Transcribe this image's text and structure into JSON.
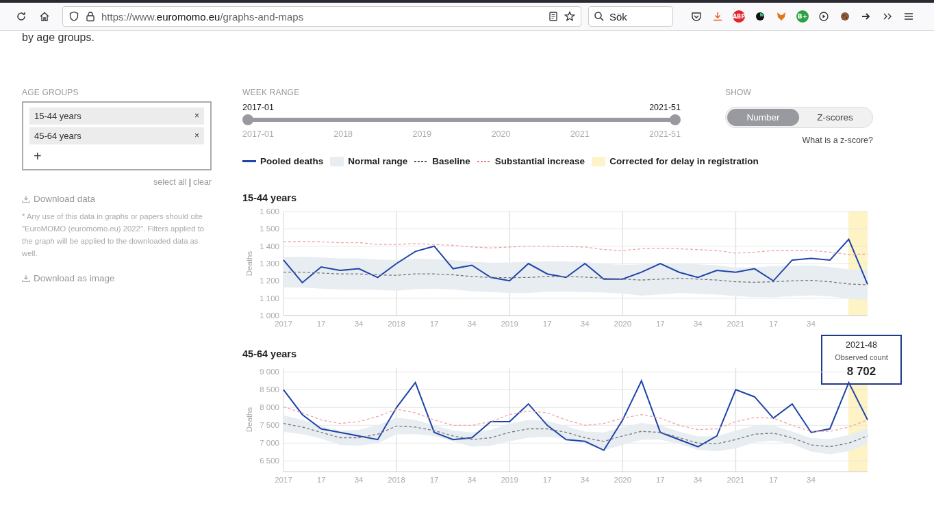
{
  "browser": {
    "url": {
      "prefix": "https://www.",
      "domain": "euromomo.eu",
      "path": "/graphs-and-maps"
    },
    "search": {
      "placeholder": "Sök"
    },
    "extensions": [
      {
        "kind": "abp",
        "label": "ABP"
      },
      {
        "kind": "bplus",
        "label": "B+"
      }
    ]
  },
  "intro": "by age groups.",
  "age_groups": {
    "heading": "AGE GROUPS",
    "chips": [
      {
        "label": "15-44 years",
        "remove": "×"
      },
      {
        "label": "45-64 years",
        "remove": "×"
      }
    ],
    "add": "+",
    "select_all": "select all",
    "separator": "|",
    "clear": "clear"
  },
  "download_data": "Download data",
  "note": "* Any use of this data in graphs or papers should cite \"EuroMOMO (euromomo.eu) 2022\". Filters applied to the graph will be applied to the downloaded data as well.",
  "download_image": "Download as image",
  "week_range": {
    "heading": "WEEK RANGE",
    "start": "2017-01",
    "end": "2021-51",
    "level": 1,
    "ticks": [
      "2017-01",
      "2018",
      "2019",
      "2020",
      "2021",
      "2021-51"
    ]
  },
  "show": {
    "heading": "SHOW",
    "options": [
      {
        "label": "Number",
        "selected": true
      },
      {
        "label": "Z-scores",
        "selected": false
      }
    ],
    "help": "What is a z-score?"
  },
  "legend": [
    {
      "kind": "line",
      "label": "Pooled deaths",
      "color": "#1e44a8"
    },
    {
      "kind": "block",
      "label": "Normal range",
      "color": "#e8edf2"
    },
    {
      "kind": "dashed",
      "label": "Baseline",
      "color": "#555555"
    },
    {
      "kind": "dashed",
      "label": "Substantial increase",
      "color": "#f08080"
    },
    {
      "kind": "block",
      "label": "Corrected for delay in registration",
      "color": "#fdf5c9"
    }
  ],
  "charts": [
    {
      "chart_data": {
        "type": "line",
        "title": "15-44 years",
        "ylabel": "Deaths",
        "categories": [
          "2017",
          null,
          "17",
          null,
          "34",
          null,
          "2018",
          null,
          "17",
          null,
          "34",
          null,
          "2019",
          null,
          "17",
          null,
          "34",
          null,
          "2020",
          null,
          "17",
          null,
          "34",
          null,
          "2021",
          null,
          "17",
          null,
          "34",
          null,
          null,
          null
        ],
        "ylim": [
          1000,
          1600
        ],
        "grid": true,
        "yticks": [
          {
            "value": 1000,
            "label": "1 000"
          },
          {
            "value": 1100,
            "label": "1 100"
          },
          {
            "value": 1200,
            "label": "1 200"
          },
          {
            "value": 1300,
            "label": "1 300"
          },
          {
            "value": 1400,
            "label": "1 400"
          },
          {
            "value": 1500,
            "label": "1 500"
          },
          {
            "value": 1600,
            "label": "1 600"
          }
        ],
        "series": [
          {
            "color": "#1e44a8",
            "line_style": "solid",
            "values": [
              1320,
              1190,
              1280,
              1260,
              1270,
              1220,
              1300,
              1370,
              1400,
              1270,
              1290,
              1220,
              1200,
              1300,
              1240,
              1220,
              1300,
              1210,
              1210,
              1250,
              1300,
              1250,
              1220,
              1260,
              1250,
              1270,
              1200,
              1320,
              1330,
              1320,
              1440,
              1180
            ]
          },
          {
            "color": "#777777",
            "line_style": "dashed",
            "values": [
              1250,
              1250,
              1245,
              1240,
              1240,
              1235,
              1232,
              1240,
              1240,
              1235,
              1225,
              1220,
              1218,
              1220,
              1225,
              1225,
              1222,
              1215,
              1210,
              1205,
              1210,
              1215,
              1210,
              1205,
              1195,
              1192,
              1195,
              1200,
              1203,
              1195,
              1182,
              1178
            ]
          },
          {
            "color": "#f4a3a3",
            "line_style": "dashed",
            "values": [
              1425,
              1428,
              1425,
              1420,
              1420,
              1410,
              1410,
              1415,
              1410,
              1405,
              1395,
              1390,
              1395,
              1400,
              1400,
              1398,
              1395,
              1380,
              1375,
              1385,
              1388,
              1385,
              1380,
              1375,
              1360,
              1365,
              1375,
              1375,
              1375,
              1365,
              1352,
              1355
            ]
          }
        ]
      }
    },
    {
      "chart_data": {
        "type": "line",
        "title": "45-64 years",
        "ylabel": "Deaths",
        "categories": [
          "2017",
          null,
          "17",
          null,
          "34",
          null,
          "2018",
          null,
          "17",
          null,
          "34",
          null,
          "2019",
          null,
          "17",
          null,
          "34",
          null,
          "2020",
          null,
          "17",
          null,
          "34",
          null,
          "2021",
          null,
          "17",
          null,
          "34",
          null,
          null,
          null
        ],
        "ylim": [
          6200,
          9120
        ],
        "grid": true,
        "yticks": [
          {
            "value": 6500,
            "label": "6 500"
          },
          {
            "value": 7000,
            "label": "7 000"
          },
          {
            "value": 7500,
            "label": "7 500"
          },
          {
            "value": 8000,
            "label": "8 000"
          },
          {
            "value": 8500,
            "label": "8 500"
          },
          {
            "value": 9000,
            "label": "9 000"
          }
        ],
        "series": [
          {
            "color": "#1e44a8",
            "line_style": "solid",
            "values": [
              8500,
              7800,
              7400,
              7300,
              7200,
              7100,
              8000,
              8700,
              7300,
              7100,
              7150,
              7600,
              7600,
              8100,
              7500,
              7100,
              7050,
              6800,
              7650,
              8750,
              7300,
              7100,
              6900,
              7200,
              8500,
              8300,
              7700,
              8100,
              7300,
              7400,
              8700,
              7650
            ]
          },
          {
            "color": "#777777",
            "line_style": "dashed",
            "values": [
              7550,
              7450,
              7300,
              7150,
              7150,
              7250,
              7480,
              7450,
              7350,
              7200,
              7100,
              7150,
              7300,
              7400,
              7400,
              7300,
              7150,
              7050,
              7200,
              7330,
              7300,
              7150,
              7000,
              6980,
              7100,
              7250,
              7280,
              7150,
              6950,
              6900,
              7000,
              7200
            ]
          },
          {
            "color": "#f4a3a3",
            "line_style": "dashed",
            "values": [
              8020,
              7850,
              7650,
              7550,
              7600,
              7750,
              7950,
              7850,
              7650,
              7500,
              7500,
              7600,
              7800,
              7900,
              7850,
              7650,
              7500,
              7550,
              7700,
              7800,
              7700,
              7500,
              7380,
              7400,
              7600,
              7720,
              7700,
              7500,
              7330,
              7330,
              7450,
              7650
            ]
          }
        ]
      }
    }
  ],
  "tooltip": {
    "week": "2021-48",
    "label": "Observed count",
    "value": "8 702"
  }
}
